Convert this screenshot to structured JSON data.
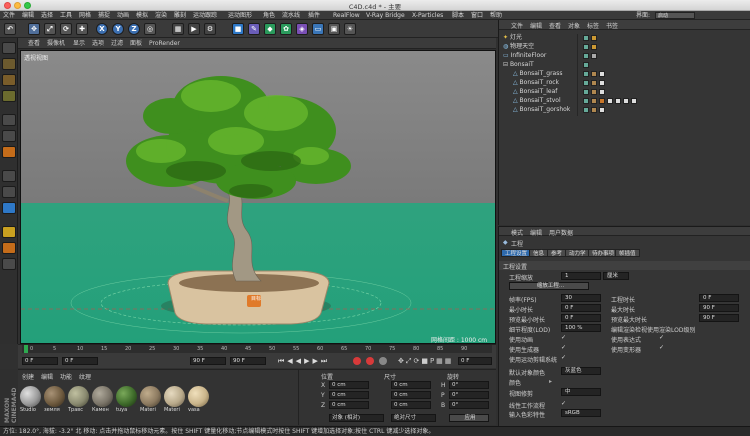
{
  "window": {
    "title": "C4D.c4d * - 主要"
  },
  "menu": [
    "文件",
    "编辑",
    "选择",
    "工具",
    "网格",
    "捕捉",
    "动画",
    "模拟",
    "渲染",
    "雕刻",
    "运动跟踪",
    "运动图形",
    "角色",
    "流水线",
    "插件",
    "RealFlow",
    "V-Ray Bridge",
    "X-Particles",
    "脚本",
    "窗口",
    "帮助"
  ],
  "interface": {
    "label": "界面:",
    "value": "启动"
  },
  "toolbar": {
    "icons": [
      "undo-icon",
      "move-icon",
      "scale-icon",
      "rotate-icon",
      "live-select-icon",
      "x-axis-icon",
      "y-axis-icon",
      "z-axis-icon",
      "world-icon",
      "render-view-icon",
      "render-icon",
      "render-settings-icon",
      "cube-icon",
      "pen-icon",
      "subdivision-icon",
      "array-icon",
      "deformer-icon",
      "floor-icon",
      "camera-icon",
      "light-icon"
    ],
    "axis_x": "X",
    "axis_y": "Y",
    "axis_z": "Z"
  },
  "viewport": {
    "menu": [
      "查看",
      "摄像机",
      "显示",
      "选项",
      "过滤",
      "面板",
      "ProRender"
    ],
    "label": "透视视图",
    "grid_distance": "网格间距 : 1000 cm",
    "annotation": "目标"
  },
  "timeline": {
    "ticks": [
      "0",
      "5",
      "10",
      "15",
      "20",
      "25",
      "30",
      "35",
      "40",
      "45",
      "50",
      "55",
      "60",
      "65",
      "70",
      "75",
      "80",
      "85",
      "90"
    ],
    "start": "0 F",
    "current": "0 F",
    "end": "90 F",
    "end2": "90 F",
    "frame_display": "0 F"
  },
  "materials": {
    "menu": [
      "创建",
      "编辑",
      "功能",
      "纹理"
    ],
    "items": [
      {
        "name": "Studio",
        "color": "#9a9a9a"
      },
      {
        "name": "земля",
        "color": "#6e5a3e"
      },
      {
        "name": "Трaвс",
        "color": "#8a8a70"
      },
      {
        "name": "Камен",
        "color": "#7a7468"
      },
      {
        "name": "tuya",
        "color": "#3e6b2a"
      },
      {
        "name": "Materi",
        "color": "#8c7a60"
      },
      {
        "name": "Materi",
        "color": "#b8a98a"
      },
      {
        "name": "vasa",
        "color": "#c9b48a"
      }
    ]
  },
  "coords": {
    "headers": [
      "位置",
      "尺寸",
      "旋转"
    ],
    "rows": [
      {
        "axis": "X",
        "pos": "0 cm",
        "size": "0 cm",
        "rlabel": "H",
        "rot": "0°"
      },
      {
        "axis": "Y",
        "pos": "0 cm",
        "size": "0 cm",
        "rlabel": "P",
        "rot": "0°"
      },
      {
        "axis": "Z",
        "pos": "0 cm",
        "size": "0 cm",
        "rlabel": "B",
        "rot": "0°"
      }
    ],
    "mode": "对象 (相对)",
    "size_mode": "绝对尺寸",
    "apply": "应用"
  },
  "objects": {
    "menu": [
      "文件",
      "编辑",
      "查看",
      "对象",
      "标签",
      "书签"
    ],
    "rows": [
      {
        "name": "灯光",
        "icon": "light-icon"
      },
      {
        "name": "物理天空",
        "icon": "sky-icon"
      },
      {
        "name": "InfiniteFloor",
        "icon": "floor-icon"
      },
      {
        "name": "BonsaiT",
        "icon": "null-icon"
      },
      {
        "name": "BonsaiT_grass",
        "icon": "mesh-icon"
      },
      {
        "name": "BonsaiT_rock",
        "icon": "mesh-icon"
      },
      {
        "name": "BonsaiT_leaf",
        "icon": "mesh-icon"
      },
      {
        "name": "BonsaiT_stvol",
        "icon": "mesh-icon"
      },
      {
        "name": "BonsaiT_gorshok",
        "icon": "mesh-icon"
      }
    ]
  },
  "attributes": {
    "menu": [
      "模式",
      "编辑",
      "用户数据"
    ],
    "section": "工程",
    "tabs": [
      "工程设置",
      "信息",
      "参考",
      "动力学",
      "待办事项",
      "帧插值"
    ],
    "group": "工程设置",
    "scale_label": "工程缩放",
    "scale_value": "1",
    "scale_unit": "厘米",
    "scale_button": "缩放工程...",
    "fps_label": "帧率(FPS)",
    "fps": "30",
    "duration_label": "工程时长",
    "duration": "0 F",
    "min_time_label": "最小时长",
    "min_time": "0 F",
    "max_time_label": "最大时长",
    "max_time": "90 F",
    "preview_min_label": "预览最小时长",
    "preview_min": "0 F",
    "preview_max_label": "预览最大时长",
    "preview_max": "90 F",
    "lod_label": "细节程度(LOD)",
    "lod": "100 %",
    "render_lod_label": "编辑渲染检视使用渲染LOD级别",
    "use_anim": "使用动画",
    "use_expr": "使用表达式",
    "use_gen": "使用生成器",
    "use_deform": "使用变形器",
    "use_motion": "使用运动剪辑系统",
    "default_color_label": "默认对象颜色",
    "default_color": "灰蓝色",
    "color_label": "颜色",
    "view_clip_label": "视图修剪",
    "view_clip": "中",
    "linear_label": "线性工作流程",
    "input_color_label": "输入色彩特性",
    "input_color": "sRGB"
  },
  "status": {
    "text": "方位: 182.0°, 海拔: -3.2° 北   移动: 点击并拖动鼠标移动元素。按住 SHIFT 键量化移动;节点编辑模式时按住 SHIFT 键增加选择对象;按住 CTRL 键减少选择对象。"
  },
  "branding": {
    "name": "MAXON CINEMA4D"
  }
}
